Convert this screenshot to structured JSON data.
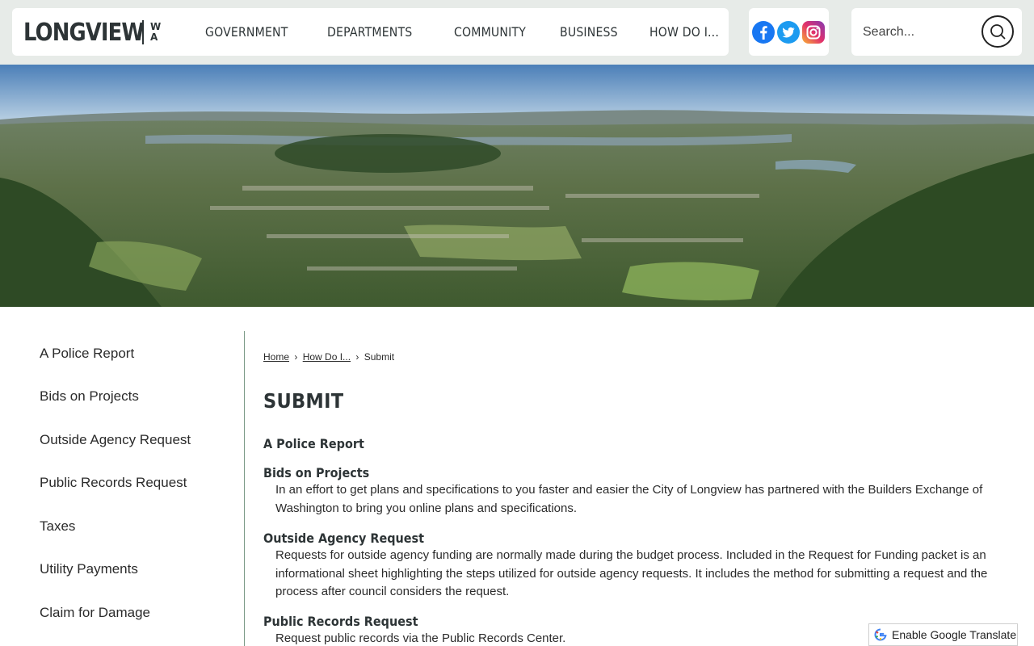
{
  "header": {
    "logo": {
      "name": "LONGVIEW",
      "state_top": "W",
      "state_bottom": "A"
    },
    "nav": [
      {
        "label": "GOVERNMENT"
      },
      {
        "label": "DEPARTMENTS"
      },
      {
        "label": "COMMUNITY"
      },
      {
        "label": "BUSINESS"
      },
      {
        "label": "HOW DO I..."
      }
    ],
    "social": [
      {
        "icon": "facebook-icon",
        "color": "#1877f2"
      },
      {
        "icon": "twitter-icon",
        "color": "#1d9bf0"
      },
      {
        "icon": "instagram-icon",
        "color": "#e1306c"
      }
    ],
    "search": {
      "placeholder": "Search...",
      "icon": "search-icon"
    }
  },
  "hero": {
    "type": "aerial-landscape-photo"
  },
  "sidebar": {
    "items": [
      {
        "label": "A Police Report"
      },
      {
        "label": "Bids on Projects"
      },
      {
        "label": "Outside Agency Request"
      },
      {
        "label": "Public Records Request"
      },
      {
        "label": "Taxes"
      },
      {
        "label": "Utility Payments"
      },
      {
        "label": "Claim for Damage"
      }
    ]
  },
  "breadcrumb": {
    "home": "Home",
    "how": "How Do I...",
    "current": "Submit",
    "separator": "›"
  },
  "main": {
    "title": "SUBMIT",
    "sections": [
      {
        "title": "A Police Report",
        "desc": ""
      },
      {
        "title": "Bids on Projects",
        "desc": "In an effort to get plans and specifications to you faster and easier the City of Longview has partnered with the Builders Exchange of Washington to bring you online plans and specifications."
      },
      {
        "title": "Outside Agency Request",
        "desc": "Requests for outside agency funding are normally made during the budget process. Included in the Request for Funding packet is an informational sheet highlighting the steps utilized for outside agency requests. It includes the method for submitting a request and the process after council considers the request."
      },
      {
        "title": "Public Records Request",
        "desc": "Request public records via the Public Records Center."
      }
    ]
  },
  "translate": {
    "label": "Enable Google Translate"
  },
  "colors": {
    "header_bg": "#e7ebe8",
    "divider": "#7a9a86",
    "text": "#2b2b2b",
    "heading": "#2d3436"
  }
}
